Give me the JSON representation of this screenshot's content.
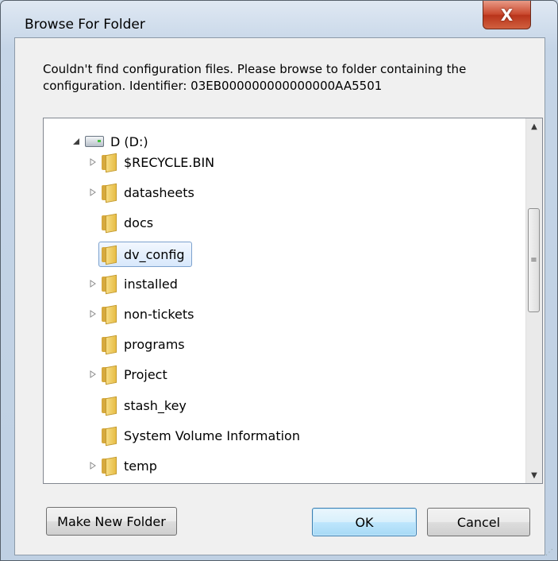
{
  "window": {
    "title": "Browse For Folder",
    "close_glyph": "X"
  },
  "message": "Couldn't find configuration files. Please browse to folder containing the configuration. Identifier: 03EB000000000000000AA5501",
  "tree": {
    "drive": {
      "label": "D (D:)",
      "icon": "drive-icon",
      "expanded": true
    },
    "folders": [
      {
        "label": "$RECYCLE.BIN",
        "expandable": true,
        "selected": false
      },
      {
        "label": "datasheets",
        "expandable": true,
        "selected": false
      },
      {
        "label": "docs",
        "expandable": false,
        "selected": false
      },
      {
        "label": "dv_config",
        "expandable": false,
        "selected": true
      },
      {
        "label": "installed",
        "expandable": true,
        "selected": false
      },
      {
        "label": "non-tickets",
        "expandable": true,
        "selected": false
      },
      {
        "label": "programs",
        "expandable": false,
        "selected": false
      },
      {
        "label": "Project",
        "expandable": true,
        "selected": false
      },
      {
        "label": "stash_key",
        "expandable": false,
        "selected": false
      },
      {
        "label": "System Volume Information",
        "expandable": false,
        "selected": false
      },
      {
        "label": "temp",
        "expandable": true,
        "selected": false
      }
    ]
  },
  "buttons": {
    "make_new_folder": "Make New Folder",
    "ok": "OK",
    "cancel": "Cancel"
  },
  "colors": {
    "selection_border": "#7da2ce",
    "close_button": "#c8462b",
    "folder": "#e7bd45"
  }
}
